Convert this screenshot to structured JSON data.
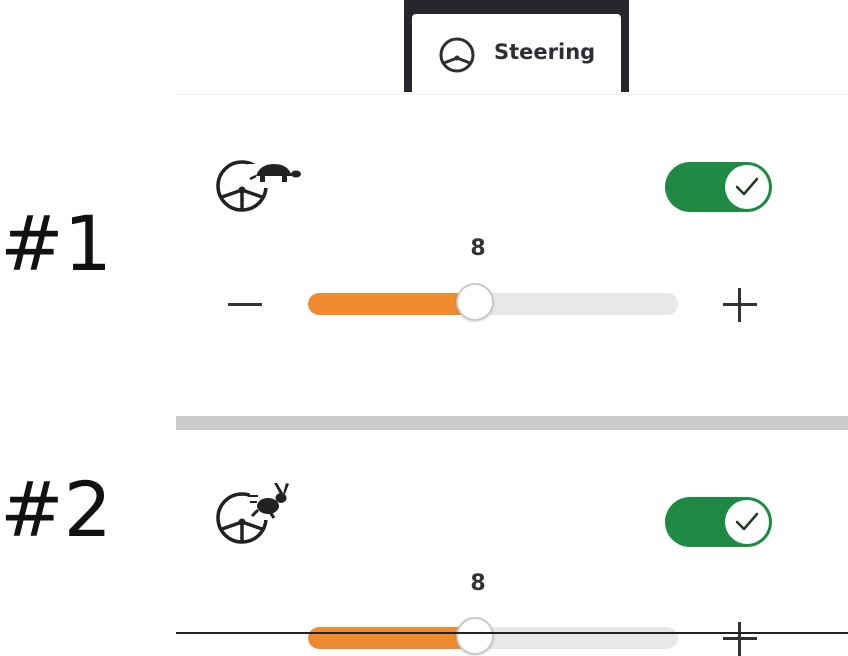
{
  "tab": {
    "label": "Steering",
    "icon": "steering-wheel-icon"
  },
  "sections": [
    {
      "marker": "#1",
      "mode_icon": "steering-wheel-turtle-icon",
      "toggle_on": true,
      "value": "8",
      "slider_fraction": 0.45
    },
    {
      "marker": "#2",
      "mode_icon": "steering-wheel-rabbit-icon",
      "toggle_on": true,
      "value": "8",
      "slider_fraction": 0.45
    }
  ],
  "colors": {
    "toggle_on": "#1e8a44",
    "slider_fill": "#ef8a2f",
    "slider_track": "#e8e8e8",
    "tab_frame": "#25272b"
  }
}
